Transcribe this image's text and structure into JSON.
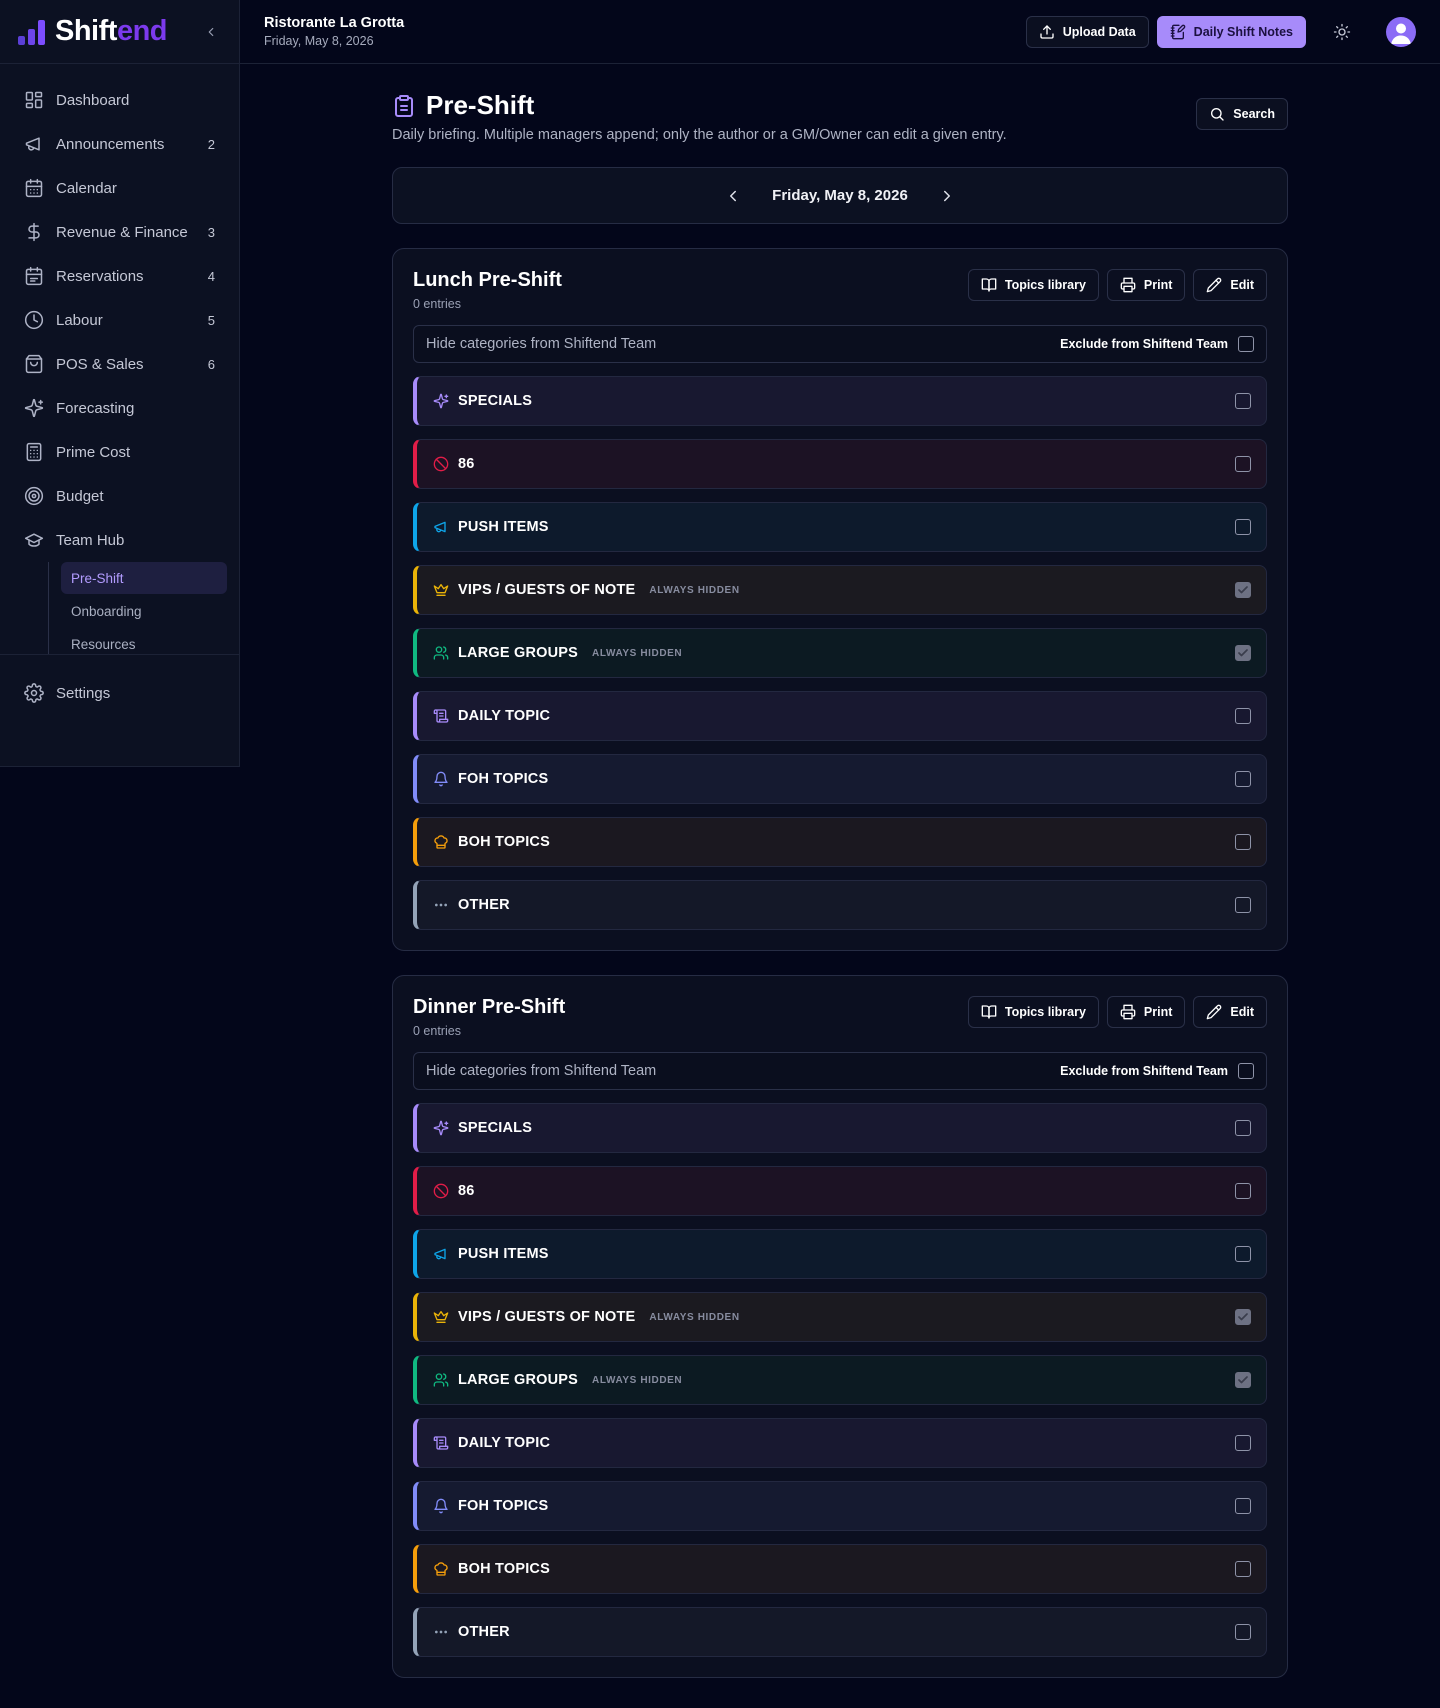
{
  "brand": {
    "name_part1": "Shift",
    "name_part2": "end"
  },
  "topbar": {
    "venue_name": "Ristorante La Grotta",
    "venue_date": "Friday, May 8, 2026",
    "upload_label": "Upload Data",
    "shift_notes_label": "Daily Shift Notes"
  },
  "sidebar": {
    "items": [
      {
        "label": "Dashboard",
        "badge": "",
        "icon": "dashboard-icon"
      },
      {
        "label": "Announcements",
        "badge": "2",
        "icon": "megaphone-icon"
      },
      {
        "label": "Calendar",
        "badge": "",
        "icon": "calendar-icon"
      },
      {
        "label": "Revenue & Finance",
        "badge": "3",
        "icon": "dollar-icon"
      },
      {
        "label": "Reservations",
        "badge": "4",
        "icon": "calendar-check-icon"
      },
      {
        "label": "Labour",
        "badge": "5",
        "icon": "clock-icon"
      },
      {
        "label": "POS & Sales",
        "badge": "6",
        "icon": "shopping-bag-icon"
      },
      {
        "label": "Forecasting",
        "badge": "",
        "icon": "sparkles-icon"
      },
      {
        "label": "Prime Cost",
        "badge": "",
        "icon": "calculator-icon"
      },
      {
        "label": "Budget",
        "badge": "",
        "icon": "target-icon"
      },
      {
        "label": "Team Hub",
        "badge": "",
        "icon": "graduation-cap-icon"
      }
    ],
    "sub_items": [
      "Pre-Shift",
      "Onboarding",
      "Resources"
    ],
    "settings_label": "Settings"
  },
  "page": {
    "title": "Pre-Shift",
    "description": "Daily briefing. Multiple managers append; only the author or a GM/Owner can edit a given entry.",
    "search_label": "Search",
    "current_date": "Friday, May 8, 2026"
  },
  "labels": {
    "topics_library": "Topics library",
    "print": "Print",
    "edit": "Edit",
    "hide_categories": "Hide categories from Shiftend Team",
    "exclude": "Exclude from Shiftend Team",
    "always_hidden": "ALWAYS HIDDEN"
  },
  "shifts": [
    {
      "title": "Lunch Pre-Shift",
      "count": "0 entries",
      "categories": [
        {
          "label": "SPECIALS",
          "color": "#a78bfa",
          "icon": "sparkles-icon",
          "checked": false,
          "always_hidden": false
        },
        {
          "label": "86",
          "color": "#e11d48",
          "icon": "ban-icon",
          "checked": false,
          "always_hidden": false
        },
        {
          "label": "PUSH ITEMS",
          "color": "#0ea5e9",
          "icon": "megaphone-icon",
          "checked": false,
          "always_hidden": false
        },
        {
          "label": "VIPS / GUESTS OF NOTE",
          "color": "#eab308",
          "icon": "crown-icon",
          "checked": true,
          "always_hidden": true
        },
        {
          "label": "LARGE GROUPS",
          "color": "#10b981",
          "icon": "users-icon",
          "checked": true,
          "always_hidden": true
        },
        {
          "label": "DAILY TOPIC",
          "color": "#a78bfa",
          "icon": "scroll-icon",
          "checked": false,
          "always_hidden": false
        },
        {
          "label": "FOH TOPICS",
          "color": "#818cf8",
          "icon": "bell-icon",
          "checked": false,
          "always_hidden": false
        },
        {
          "label": "BOH TOPICS",
          "color": "#f59e0b",
          "icon": "chef-hat-icon",
          "checked": false,
          "always_hidden": false
        },
        {
          "label": "OTHER",
          "color": "#94a3b8",
          "icon": "more-horizontal-icon",
          "checked": false,
          "always_hidden": false
        }
      ]
    },
    {
      "title": "Dinner Pre-Shift",
      "count": "0 entries",
      "categories": [
        {
          "label": "SPECIALS",
          "color": "#a78bfa",
          "icon": "sparkles-icon",
          "checked": false,
          "always_hidden": false
        },
        {
          "label": "86",
          "color": "#e11d48",
          "icon": "ban-icon",
          "checked": false,
          "always_hidden": false
        },
        {
          "label": "PUSH ITEMS",
          "color": "#0ea5e9",
          "icon": "megaphone-icon",
          "checked": false,
          "always_hidden": false
        },
        {
          "label": "VIPS / GUESTS OF NOTE",
          "color": "#eab308",
          "icon": "crown-icon",
          "checked": true,
          "always_hidden": true
        },
        {
          "label": "LARGE GROUPS",
          "color": "#10b981",
          "icon": "users-icon",
          "checked": true,
          "always_hidden": true
        },
        {
          "label": "DAILY TOPIC",
          "color": "#a78bfa",
          "icon": "scroll-icon",
          "checked": false,
          "always_hidden": false
        },
        {
          "label": "FOH TOPICS",
          "color": "#818cf8",
          "icon": "bell-icon",
          "checked": false,
          "always_hidden": false
        },
        {
          "label": "BOH TOPICS",
          "color": "#f59e0b",
          "icon": "chef-hat-icon",
          "checked": false,
          "always_hidden": false
        },
        {
          "label": "OTHER",
          "color": "#94a3b8",
          "icon": "more-horizontal-icon",
          "checked": false,
          "always_hidden": false
        }
      ]
    }
  ]
}
